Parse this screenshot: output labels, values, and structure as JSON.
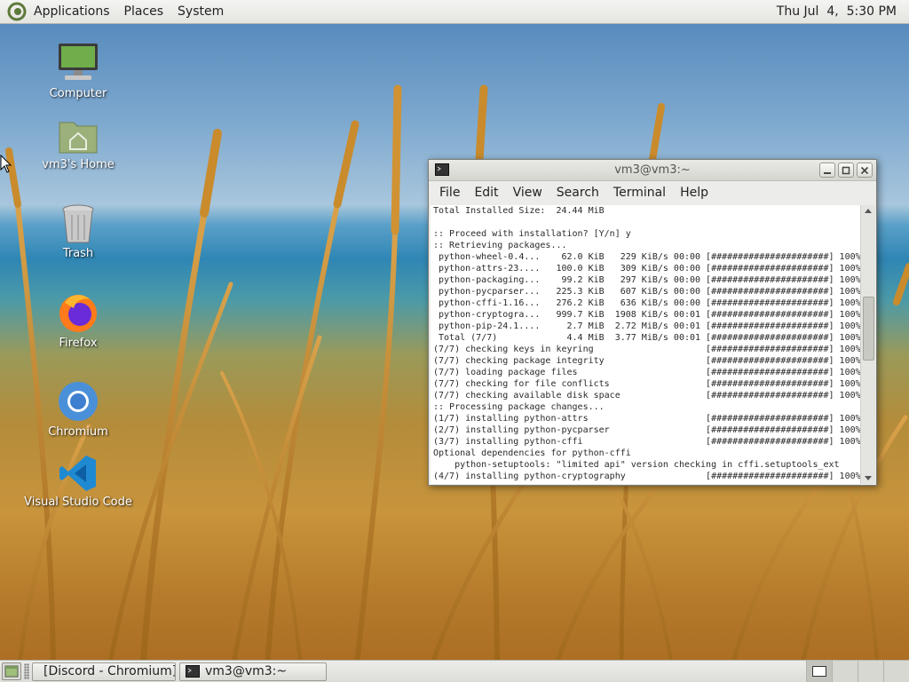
{
  "top_panel": {
    "menus": [
      "Applications",
      "Places",
      "System"
    ],
    "clock": "Thu Jul  4,  5:30 PM"
  },
  "desktop_icons": [
    {
      "label": "Computer",
      "icon": "computer-icon"
    },
    {
      "label": "vm3's Home",
      "icon": "home-folder-icon"
    },
    {
      "label": "Trash",
      "icon": "trash-icon"
    },
    {
      "label": "Firefox",
      "icon": "firefox-icon"
    },
    {
      "label": "Chromium",
      "icon": "chromium-icon"
    },
    {
      "label": "Visual Studio Code",
      "icon": "vscode-icon"
    }
  ],
  "terminal": {
    "title": "vm3@vm3:~",
    "menu": [
      "File",
      "Edit",
      "View",
      "Search",
      "Terminal",
      "Help"
    ],
    "lines": [
      "Total Installed Size:  24.44 MiB",
      "",
      ":: Proceed with installation? [Y/n] y",
      ":: Retrieving packages...",
      " python-wheel-0.4...    62.0 KiB   229 KiB/s 00:00 [######################] 100%",
      " python-attrs-23....   100.0 KiB   309 KiB/s 00:00 [######################] 100%",
      " python-packaging...    99.2 KiB   297 KiB/s 00:00 [######################] 100%",
      " python-pycparser...   225.3 KiB   607 KiB/s 00:00 [######################] 100%",
      " python-cffi-1.16...   276.2 KiB   636 KiB/s 00:00 [######################] 100%",
      " python-cryptogra...   999.7 KiB  1908 KiB/s 00:01 [######################] 100%",
      " python-pip-24.1....     2.7 MiB  2.72 MiB/s 00:01 [######################] 100%",
      " Total (7/7)             4.4 MiB  3.77 MiB/s 00:01 [######################] 100%",
      "(7/7) checking keys in keyring                     [######################] 100%",
      "(7/7) checking package integrity                   [######################] 100%",
      "(7/7) loading package files                        [######################] 100%",
      "(7/7) checking for file conflicts                  [######################] 100%",
      "(7/7) checking available disk space                [######################] 100%",
      ":: Processing package changes...",
      "(1/7) installing python-attrs                      [######################] 100%",
      "(2/7) installing python-pycparser                  [######################] 100%",
      "(3/7) installing python-cffi                       [######################] 100%",
      "Optional dependencies for python-cffi",
      "    python-setuptools: \"limited api\" version checking in cffi.setuptools_ext",
      "(4/7) installing python-cryptography               [######################] 100%"
    ]
  },
  "taskbar": {
    "tasks": [
      {
        "label": "[Discord - Chromium]",
        "icon": "chromium-icon"
      },
      {
        "label": "vm3@vm3:~",
        "icon": "terminal-icon"
      }
    ]
  },
  "colors": {
    "panel_bg": "#e4e4e0",
    "terminal_bg": "#ffffff",
    "desktop_text": "#ffffff"
  }
}
